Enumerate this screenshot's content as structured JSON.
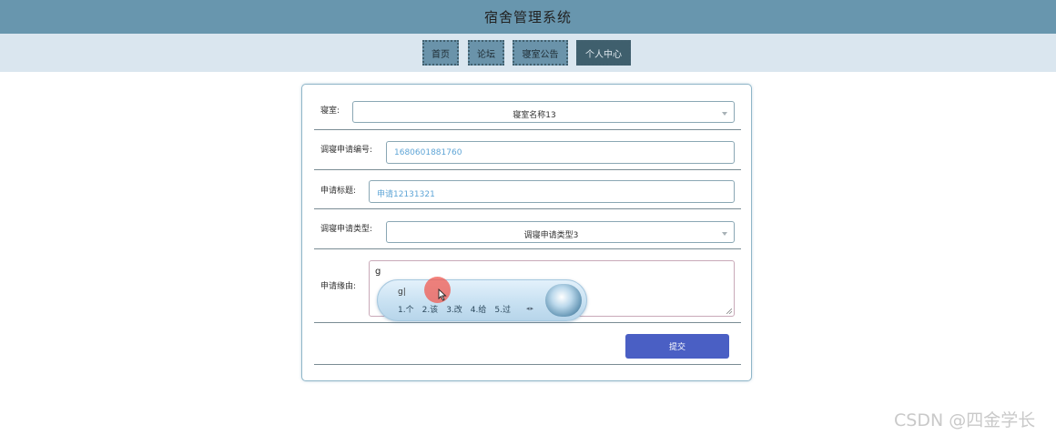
{
  "header": {
    "title": "宿舍管理系统"
  },
  "nav": {
    "items": [
      {
        "label": "首页"
      },
      {
        "label": "论坛"
      },
      {
        "label": "寝室公告"
      },
      {
        "label": "个人中心"
      }
    ],
    "active_index": 3
  },
  "form": {
    "room": {
      "label": "寝室:",
      "value": "寝室名称13"
    },
    "app_no": {
      "label": "调寝申请编号:",
      "value": "1680601881760"
    },
    "app_title": {
      "label": "申请标题:",
      "value": "申请12131321"
    },
    "app_type": {
      "label": "调寝申请类型:",
      "value": "调寝申请类型3"
    },
    "reason": {
      "label": "申请缘由:",
      "value": "g"
    },
    "submit_label": "提交"
  },
  "ime": {
    "composition": "g|",
    "candidates": [
      "1.个",
      "2.该",
      "3.改",
      "4.给",
      "5.过"
    ]
  },
  "watermark": "CSDN @四金学长",
  "colors": {
    "header_bg": "#6896ae",
    "nav_bg": "#dae6ef",
    "nav_item_bg": "#6a93aa",
    "nav_active_bg": "#3f5f6d",
    "submit_bg": "#4a5fc4"
  }
}
